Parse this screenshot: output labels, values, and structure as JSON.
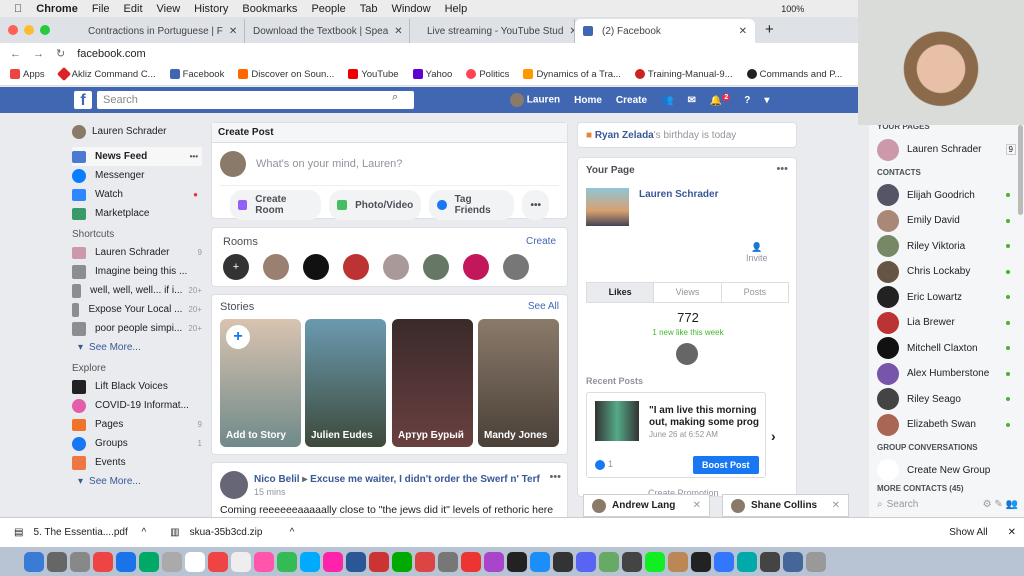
{
  "menubar": {
    "app": "Chrome",
    "items": [
      "File",
      "Edit",
      "View",
      "History",
      "Bookmarks",
      "People",
      "Tab",
      "Window",
      "Help"
    ],
    "battery": "100%"
  },
  "tabs": [
    {
      "label": "Contractions in Portuguese | F"
    },
    {
      "label": "Download the Textbook | Spea"
    },
    {
      "label": "Live streaming - YouTube Stud"
    },
    {
      "label": "(2) Facebook"
    }
  ],
  "address": {
    "url": "facebook.com"
  },
  "bookmarks": [
    "Apps",
    "Akliz Command C...",
    "Facebook",
    "Discover on Soun...",
    "YouTube",
    "Yahoo",
    "Politics",
    "Dynamics of a Tra...",
    "Training-Manual-9...",
    "Commands and P..."
  ],
  "header": {
    "search_placeholder": "Search",
    "user": "Lauren",
    "home": "Home",
    "create": "Create",
    "notif_count": "2"
  },
  "left": {
    "profile": "Lauren Schrader",
    "nav": [
      {
        "label": "News Feed"
      },
      {
        "label": "Messenger"
      },
      {
        "label": "Watch"
      },
      {
        "label": "Marketplace"
      }
    ],
    "shortcuts_title": "Shortcuts",
    "shortcuts": [
      {
        "label": "Lauren Schrader",
        "n": "9"
      },
      {
        "label": "Imagine being this ...",
        "n": ""
      },
      {
        "label": "well, well, well... if i...",
        "n": "20+"
      },
      {
        "label": "Expose Your Local ...",
        "n": "20+"
      },
      {
        "label": "poor people simpi...",
        "n": "20+"
      }
    ],
    "see_more": "See More...",
    "explore_title": "Explore",
    "explore": [
      {
        "label": "Lift Black Voices",
        "n": ""
      },
      {
        "label": "COVID-19 Informat...",
        "n": ""
      },
      {
        "label": "Pages",
        "n": "9"
      },
      {
        "label": "Groups",
        "n": "1"
      },
      {
        "label": "Events",
        "n": ""
      }
    ]
  },
  "create_post": {
    "title": "Create Post",
    "placeholder": "What's on your mind, Lauren?",
    "actions": [
      "Create Room",
      "Photo/Video",
      "Tag Friends"
    ]
  },
  "rooms": {
    "title": "Rooms",
    "create": "Create"
  },
  "stories": {
    "title": "Stories",
    "see_all": "See All",
    "items": [
      "Add to Story",
      "Julien Eudes",
      "Артур Бурый",
      "Mandy Jones"
    ]
  },
  "post": {
    "author": "Nico Belil",
    "group": "Excuse me waiter, I didn't order the Swerf n' Terf",
    "time": "15 mins",
    "text": "Coming reeeeeeaaaaally close to \"the jews did it\" levels of rethoric here"
  },
  "birthday": {
    "name": "Ryan Zelada",
    "text": "'s birthday is today"
  },
  "your_page": {
    "title": "Your Page",
    "name": "Lauren Schrader",
    "invite": "Invite",
    "tabs": [
      "Likes",
      "Views",
      "Posts"
    ],
    "likes": "772",
    "new_likes": "1 new like this week",
    "recent_title": "Recent Posts",
    "recent_text": "\"I am live this morning out, making some prog",
    "recent_date": "June 26 at 6:52 AM",
    "reactions": "1",
    "boost": "Boost Post",
    "promo": "Create Promotion"
  },
  "chats": [
    "Andrew Lang",
    "Shane Collins"
  ],
  "contacts": {
    "pages_title": "YOUR PAGES",
    "page": "Lauren Schrader",
    "page_n": "9",
    "title": "CONTACTS",
    "items": [
      "Elijah Goodrich",
      "Emily David",
      "Riley Viktoria",
      "Chris Lockaby",
      "Eric Lowartz",
      "Lia Brewer",
      "Mitchell Claxton",
      "Alex Humberstone",
      "Riley Seago",
      "Elizabeth Swan"
    ],
    "group_title": "GROUP CONVERSATIONS",
    "create_group": "Create New Group",
    "more": "MORE CONTACTS (45)",
    "search": "Search"
  },
  "downloads": {
    "items": [
      "5. The Essentia....pdf",
      "skua-35b3cd.zip"
    ],
    "show_all": "Show All"
  },
  "colors": {
    "fb_blue": "#4267b2",
    "online": "#42b72a"
  }
}
